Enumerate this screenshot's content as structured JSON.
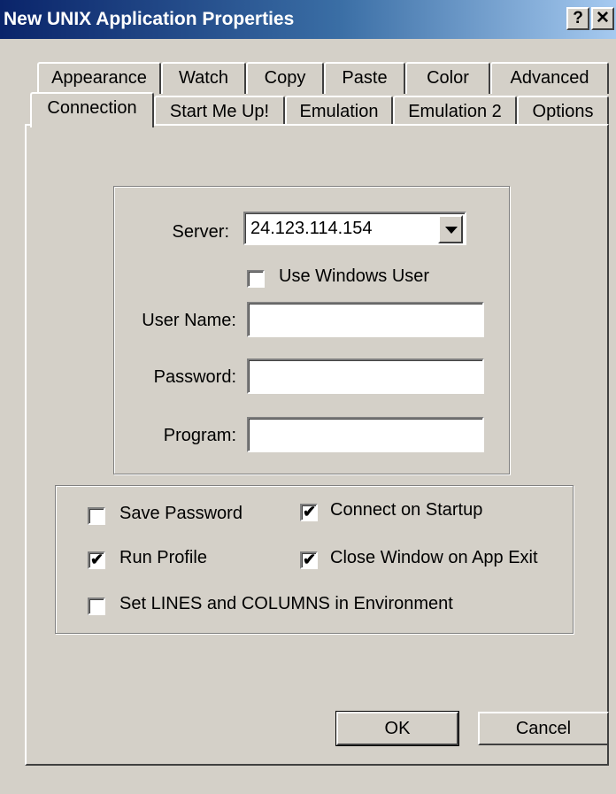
{
  "window": {
    "title": "New UNIX Application Properties",
    "help_label": "?",
    "close_label": "✕"
  },
  "tabs_row1": [
    "Appearance",
    "Watch",
    "Copy",
    "Paste",
    "Color",
    "Advanced"
  ],
  "tabs_row2": [
    "Connection",
    "Start Me Up!",
    "Emulation",
    "Emulation 2",
    "Options"
  ],
  "active_tab": "Connection",
  "connection": {
    "server_label": "Server:",
    "server_value": "24.123.114.154",
    "use_windows_user_label": "Use Windows User",
    "use_windows_user_checked": false,
    "user_name_label": "User Name:",
    "user_name_value": "",
    "password_label": "Password:",
    "password_value": "",
    "program_label": "Program:",
    "program_value": ""
  },
  "options": {
    "save_password": {
      "label": "Save Password",
      "checked": false
    },
    "connect_on_startup": {
      "label": "Connect on Startup",
      "checked": true
    },
    "run_profile": {
      "label": "Run Profile",
      "checked": true
    },
    "close_window_on_app_exit": {
      "label": "Close Window on App Exit",
      "checked": true
    },
    "set_lines_columns": {
      "label": "Set LINES and COLUMNS in Environment",
      "checked": false
    }
  },
  "buttons": {
    "ok_label": "OK",
    "cancel_label": "Cancel"
  },
  "icons": {
    "dropdown": "chevron-down-icon",
    "check": "check-icon"
  },
  "colors": {
    "titlebar_start": "#0a246a",
    "titlebar_end": "#a6caf0",
    "face": "#d4d0c8"
  }
}
